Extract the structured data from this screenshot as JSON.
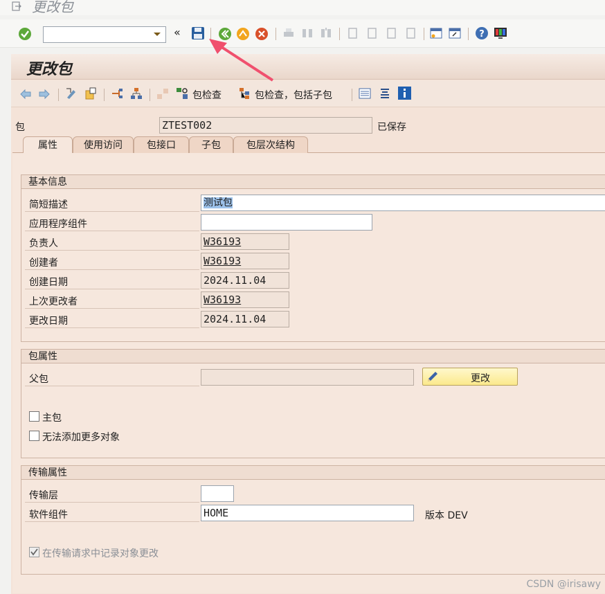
{
  "window": {
    "title": "更改包"
  },
  "system_toolbar": {
    "command_field": {
      "value": "",
      "placeholder": ""
    },
    "history_label": "«",
    "icons": [
      "enter-icon",
      "save-icon",
      "back-icon",
      "exit-icon",
      "cancel-icon",
      "print-icon",
      "find-icon",
      "find-next-icon",
      "first-page-icon",
      "prev-page-icon",
      "next-page-icon",
      "last-page-icon",
      "new-session-icon",
      "shortcut-icon",
      "help-icon",
      "layout-icon"
    ]
  },
  "panel": {
    "title": "更改包"
  },
  "app_toolbar": {
    "package_check_label": "包检查",
    "package_check_sub_label": "包检查，包括子包"
  },
  "header": {
    "package_label": "包",
    "package_value": "ZTEST002",
    "status": "已保存"
  },
  "tabs": [
    {
      "label": "属性",
      "active": true
    },
    {
      "label": "使用访问",
      "active": false
    },
    {
      "label": "包接口",
      "active": false
    },
    {
      "label": "子包",
      "active": false
    },
    {
      "label": "包层次结构",
      "active": false
    }
  ],
  "basic_info": {
    "title": "基本信息",
    "fields": [
      {
        "label": "简短描述",
        "value": "测试包"
      },
      {
        "label": "应用程序组件",
        "value": ""
      },
      {
        "label": "负责人",
        "value": "W36193"
      },
      {
        "label": "创建者",
        "value": "W36193"
      },
      {
        "label": "创建日期",
        "value": "2024.11.04"
      },
      {
        "label": "上次更改者",
        "value": "W36193"
      },
      {
        "label": "更改日期",
        "value": "2024.11.04"
      }
    ]
  },
  "package_attrs": {
    "title": "包属性",
    "parent_label": "父包",
    "parent_value": "",
    "change_button": "更改",
    "main_package": {
      "label": "主包",
      "checked": false
    },
    "no_more_objects": {
      "label": "无法添加更多对象",
      "checked": false
    }
  },
  "transport_attrs": {
    "title": "传输属性",
    "layer_label": "传输层",
    "layer_value": "",
    "component_label": "软件组件",
    "component_value": "HOME",
    "version_text": "版本 DEV",
    "record_changes": {
      "label": "在传输请求中记录对象更改",
      "checked": true
    }
  },
  "watermark": "CSDN @irisawy",
  "colors": {
    "accent_arrow": "#f0506e",
    "panel_bg": "#f4e3d8",
    "button_yellow": "#fbe98c"
  }
}
